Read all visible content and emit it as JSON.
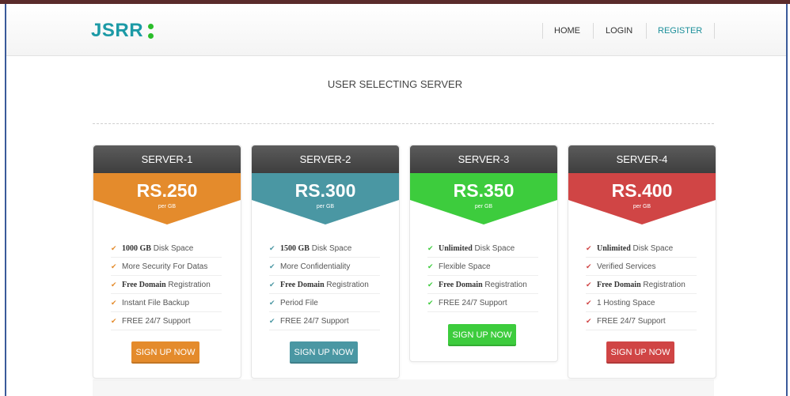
{
  "brand": {
    "name": "JSRR"
  },
  "nav": {
    "items": [
      {
        "label": "HOME",
        "active": false
      },
      {
        "label": "LOGIN",
        "active": false
      },
      {
        "label": "REGISTER",
        "active": true
      }
    ]
  },
  "page": {
    "title": "USER SELECTING SERVER"
  },
  "plans": [
    {
      "name": "SERVER-1",
      "price": "RS.250",
      "unit": "per GB",
      "color": "#e48b2c",
      "features": [
        {
          "bold": "1000 GB",
          "text": " Disk Space"
        },
        {
          "bold": "",
          "text": "More Security For Datas"
        },
        {
          "bold": "Free Domain",
          "text": " Registration"
        },
        {
          "bold": "",
          "text": "Instant File Backup"
        },
        {
          "bold": "",
          "text": "FREE 24/7 Support"
        }
      ],
      "button": "SIGN UP NOW"
    },
    {
      "name": "SERVER-2",
      "price": "RS.300",
      "unit": "per GB",
      "color": "#4a97a3",
      "features": [
        {
          "bold": "1500 GB",
          "text": " Disk Space"
        },
        {
          "bold": "",
          "text": "More Confidentiality"
        },
        {
          "bold": "Free Domain",
          "text": " Registration"
        },
        {
          "bold": "",
          "text": "Period File"
        },
        {
          "bold": "",
          "text": "FREE 24/7 Support"
        }
      ],
      "button": "SIGN UP NOW"
    },
    {
      "name": "SERVER-3",
      "price": "RS.350",
      "unit": "per GB",
      "color": "#3dcc3d",
      "features": [
        {
          "bold": "Unlimited",
          "text": " Disk Space"
        },
        {
          "bold": "",
          "text": "Flexible Space"
        },
        {
          "bold": "Free Domain",
          "text": " Registration"
        },
        {
          "bold": "",
          "text": "FREE 24/7 Support"
        }
      ],
      "button": "SIGN UP NOW"
    },
    {
      "name": "SERVER-4",
      "price": "RS.400",
      "unit": "per GB",
      "color": "#d04545",
      "features": [
        {
          "bold": "Unlimited",
          "text": " Disk Space"
        },
        {
          "bold": "",
          "text": "Verified Services"
        },
        {
          "bold": "Free Domain",
          "text": " Registration"
        },
        {
          "bold": "",
          "text": "1 Hosting Space"
        },
        {
          "bold": "",
          "text": "FREE 24/7 Support"
        }
      ],
      "button": "SIGN UP NOW"
    }
  ],
  "icons": {
    "check": "check-icon"
  }
}
